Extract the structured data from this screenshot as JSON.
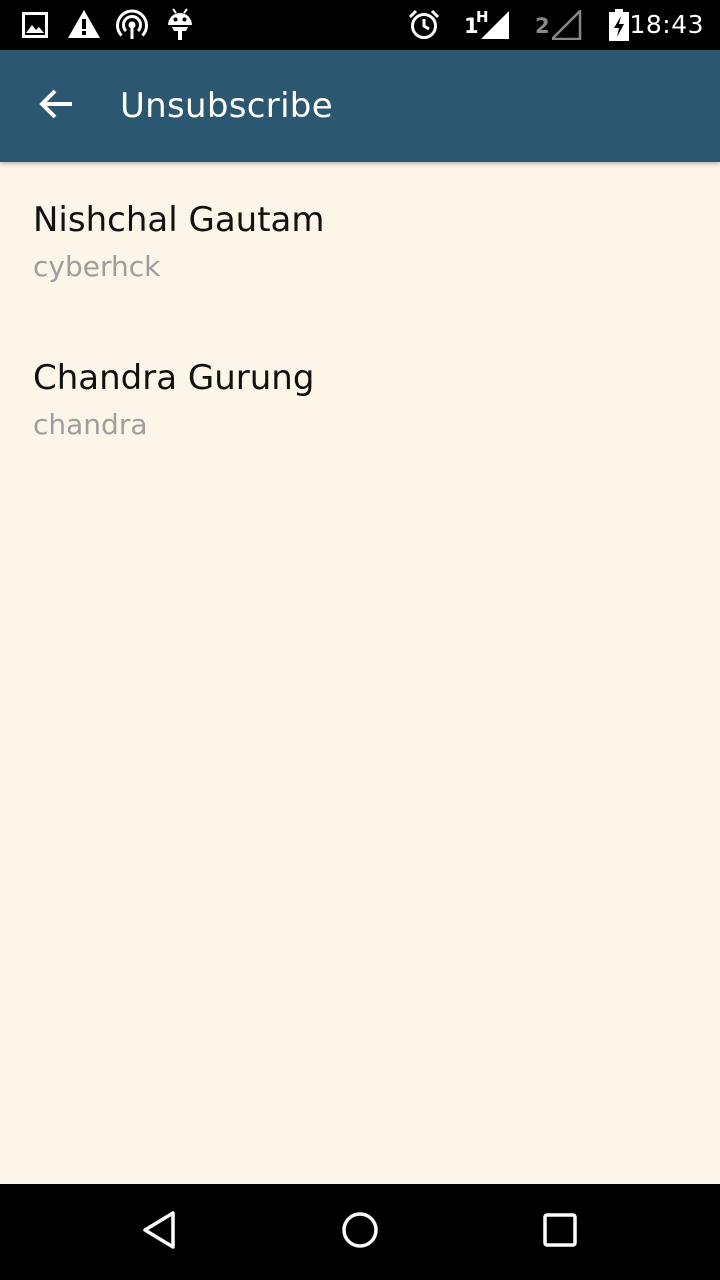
{
  "status_bar": {
    "time": "18:43",
    "sim1": "1",
    "sim1_net": "H",
    "sim2": "2",
    "icons": [
      "image-icon",
      "warning-icon",
      "hotspot-icon",
      "android-icon",
      "alarm-icon",
      "signal-icon",
      "signal-empty-icon",
      "battery-charging-icon"
    ]
  },
  "app_bar": {
    "title": "Unsubscribe",
    "back_icon": "arrow-back-icon",
    "color": "#2c5770"
  },
  "list": {
    "items": [
      {
        "name": "Nishchal Gautam",
        "username": "cyberhck"
      },
      {
        "name": "Chandra Gurung",
        "username": "chandra"
      }
    ]
  },
  "nav_bar": {
    "buttons": [
      "back-icon",
      "home-icon",
      "recents-icon"
    ]
  },
  "colors": {
    "background": "#fdf5e8",
    "secondary_text": "#9e9e9e"
  }
}
